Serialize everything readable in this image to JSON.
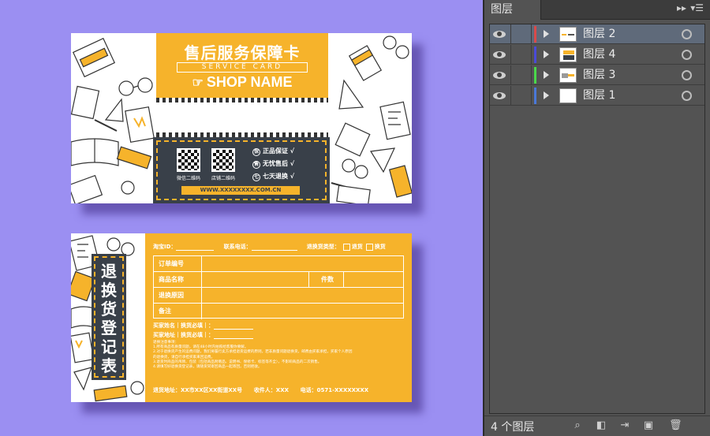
{
  "canvas": {
    "background": "#9b8ff2",
    "accent": "#f6b32b",
    "dark": "#394049"
  },
  "front_card": {
    "title": "售后服务保障卡",
    "subtitle": "SERVICE CARD",
    "shop_name": "SHOP NAME",
    "qr_labels": [
      "微信二维码",
      "店铺二维码"
    ],
    "features": [
      {
        "mark": "保",
        "text": "正品保证 √"
      },
      {
        "mark": "售",
        "text": "无忧售后 √"
      },
      {
        "mark": "七",
        "text": "七天退换 √"
      }
    ],
    "url": "WWW.XXXXXXXX.COM.CN"
  },
  "back_card": {
    "badge_title": "退换货登记表",
    "taobao_id_label": "淘宝ID：",
    "phone_label": "联系电话：",
    "type_label": "退换货类型：",
    "type_options": [
      "退货",
      "换货"
    ],
    "table_rows": [
      "订单编号",
      "商品名称",
      "退换原因",
      "备注"
    ],
    "quantity_label": "件数",
    "buyer_name_label": "买家姓名｜换货必填｜：",
    "buyer_addr_label": "买家地址｜换货必填｜：",
    "notes_title": "退换注意事项：",
    "notes": [
      "1.所有商品有质量问题，请在48小时内拍照给客服你要解。",
      "2.对于退换货产生的运费问题，我们将履行卖方承担退货运费的原则，若非质量问题退换货，邮费由买家承担，买家个人原因",
      "  的退换货，请自行承担买家来回运费。",
      "3.退货时商品的吊牌、包装（包括商品附赠品、说明书、保修卡、标签等齐全），不影响商品的二次销售。",
      "4.请填写好退换货登记表，请随货同寄回商品一起寄回，否则拒收。"
    ],
    "return_address_label": "退货地址：XX市XX区XX街道XX号",
    "recipient_label": "收件人：XXX",
    "phone_value": "电话：0571-XXXXXXXX"
  },
  "layers_panel": {
    "tab_title": "图层",
    "layers": [
      {
        "name": "图层 2",
        "color": "#d94a4a",
        "selected": true
      },
      {
        "name": "图层 4",
        "color": "#4a4ad9",
        "selected": false
      },
      {
        "name": "图层 3",
        "color": "#4ad94a",
        "selected": false
      },
      {
        "name": "图层 1",
        "color": "#4a78d9",
        "selected": false
      }
    ],
    "footer_count": "4 个图层"
  }
}
